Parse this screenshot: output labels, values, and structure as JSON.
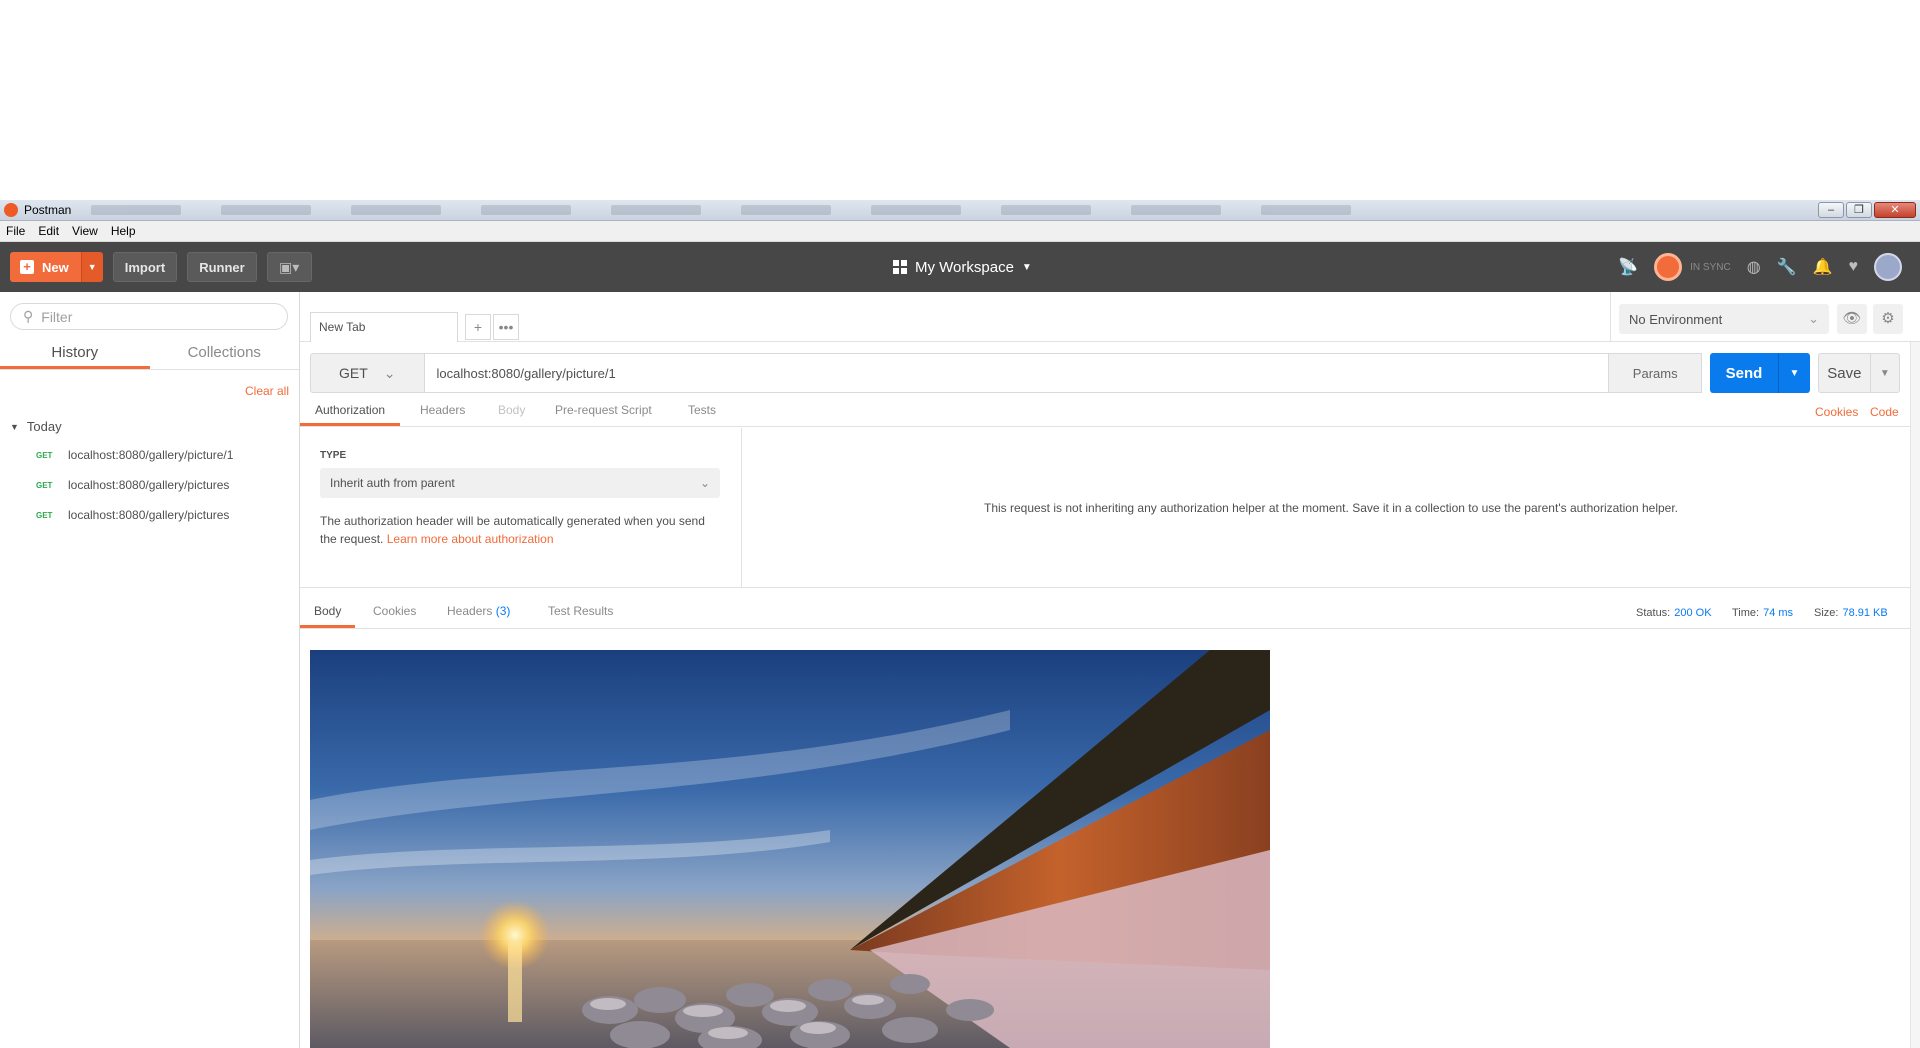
{
  "window": {
    "title": "Postman",
    "controls": [
      "–",
      "❐",
      "✕"
    ]
  },
  "menubar": [
    "File",
    "Edit",
    "View",
    "Help"
  ],
  "header": {
    "new_label": "New",
    "import_label": "Import",
    "runner_label": "Runner",
    "workspace_label": "My Workspace",
    "sync_label": "IN SYNC"
  },
  "sidebar": {
    "filter_placeholder": "Filter",
    "tabs": [
      "History",
      "Collections"
    ],
    "clear_all": "Clear all",
    "group": "Today",
    "items": [
      {
        "method": "GET",
        "url": "localhost:8080/gallery/picture/1"
      },
      {
        "method": "GET",
        "url": "localhost:8080/gallery/pictures"
      },
      {
        "method": "GET",
        "url": "localhost:8080/gallery/pictures"
      }
    ]
  },
  "tabs": {
    "current": "New Tab"
  },
  "environment": {
    "selected": "No Environment"
  },
  "request": {
    "method": "GET",
    "url": "localhost:8080/gallery/picture/1",
    "params_label": "Params",
    "send_label": "Send",
    "save_label": "Save",
    "subtabs": [
      "Authorization",
      "Headers",
      "Body",
      "Pre-request Script",
      "Tests"
    ],
    "cookies_link": "Cookies",
    "code_link": "Code"
  },
  "auth": {
    "type_label": "TYPE",
    "type_value": "Inherit auth from parent",
    "desc": "The authorization header will be automatically generated when you send the request.",
    "learn_more": "Learn more about authorization",
    "info": "This request is not inheriting any authorization helper at the moment. Save it in a collection to use the parent's authorization helper."
  },
  "response": {
    "tabs": {
      "body": "Body",
      "cookies": "Cookies",
      "headers": "Headers",
      "headers_count": "(3)",
      "tests": "Test Results"
    },
    "status_label": "Status:",
    "status_value": "200 OK",
    "time_label": "Time:",
    "time_value": "74 ms",
    "size_label": "Size:",
    "size_value": "78.91 KB"
  },
  "colors": {
    "accent": "#f26b3a",
    "primary": "#097bed",
    "header_bg": "#474747",
    "get_green": "#2ea84d"
  }
}
